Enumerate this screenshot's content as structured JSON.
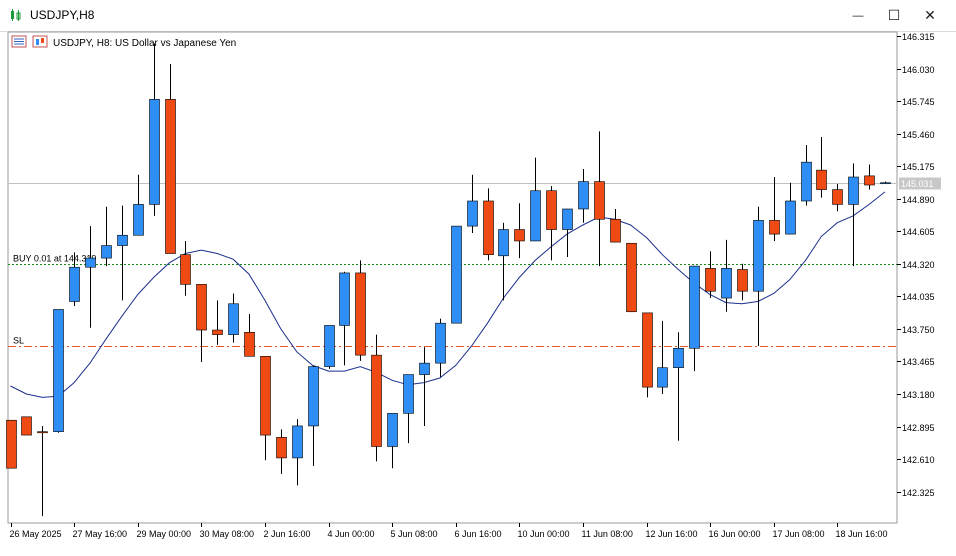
{
  "window": {
    "title": "USDJPY,H8",
    "minimize_glyph": "—",
    "maximize_glyph": "☐",
    "close_glyph": "✕"
  },
  "chart_header": {
    "text": "USDJPY, H8:  US Dollar vs Japanese Yen"
  },
  "lines": {
    "buy_label": "BUY 0.01 at 144.319",
    "buy_price": 144.319,
    "sl_label": "SL",
    "sl_price": 143.6,
    "current_price": 145.031,
    "current_price_label": "145.031"
  },
  "colors": {
    "bull": "#2f8ef5",
    "bear": "#f04a14",
    "wick": "#000000",
    "ma": "#1c2f8c",
    "buy_line": "#1a8a1a",
    "sl_line": "#e8532a",
    "price_line": "#c0c0c0"
  },
  "chart_data": {
    "type": "candlestick",
    "symbol": "USDJPY",
    "timeframe": "H8",
    "ylim": [
      142.05,
      146.35
    ],
    "y_ticks": [
      "146.315",
      "146.030",
      "145.745",
      "145.460",
      "145.175",
      "144.890",
      "144.605",
      "144.320",
      "144.035",
      "143.750",
      "143.465",
      "143.180",
      "142.895",
      "142.610",
      "142.325"
    ],
    "x_labels": [
      "26 May 2025",
      "27 May 16:00",
      "29 May 00:00",
      "30 May 08:00",
      "2 Jun 16:00",
      "4 Jun 00:00",
      "5 Jun 08:00",
      "6 Jun 16:00",
      "10 Jun 00:00",
      "11 Jun 08:00",
      "12 Jun 16:00",
      "16 Jun 00:00",
      "17 Jun 08:00",
      "18 Jun 16:00"
    ],
    "candles": [
      {
        "o": 142.95,
        "h": 142.95,
        "l": 142.53,
        "c": 142.53
      },
      {
        "o": 142.98,
        "h": 142.98,
        "l": 142.85,
        "c": 142.82
      },
      {
        "o": 142.85,
        "h": 142.9,
        "l": 142.11,
        "c": 142.84
      },
      {
        "o": 142.85,
        "h": 143.92,
        "l": 142.84,
        "c": 143.92
      },
      {
        "o": 143.99,
        "h": 144.42,
        "l": 143.95,
        "c": 144.29
      },
      {
        "o": 144.29,
        "h": 144.65,
        "l": 143.76,
        "c": 144.37
      },
      {
        "o": 144.37,
        "h": 144.82,
        "l": 144.3,
        "c": 144.48
      },
      {
        "o": 144.48,
        "h": 144.83,
        "l": 144.0,
        "c": 144.57
      },
      {
        "o": 144.57,
        "h": 145.1,
        "l": 144.57,
        "c": 144.84
      },
      {
        "o": 144.84,
        "h": 146.25,
        "l": 144.74,
        "c": 145.76
      },
      {
        "o": 145.76,
        "h": 146.07,
        "l": 144.41,
        "c": 144.41
      },
      {
        "o": 144.4,
        "h": 144.52,
        "l": 144.04,
        "c": 144.14
      },
      {
        "o": 144.14,
        "h": 144.14,
        "l": 143.46,
        "c": 143.74
      },
      {
        "o": 143.74,
        "h": 144.0,
        "l": 143.61,
        "c": 143.7
      },
      {
        "o": 143.7,
        "h": 144.06,
        "l": 143.63,
        "c": 143.97
      },
      {
        "o": 143.72,
        "h": 143.88,
        "l": 143.54,
        "c": 143.51
      },
      {
        "o": 143.51,
        "h": 143.51,
        "l": 142.6,
        "c": 142.82
      },
      {
        "o": 142.8,
        "h": 142.87,
        "l": 142.48,
        "c": 142.62
      },
      {
        "o": 142.62,
        "h": 142.96,
        "l": 142.38,
        "c": 142.9
      },
      {
        "o": 142.9,
        "h": 143.43,
        "l": 142.55,
        "c": 143.42
      },
      {
        "o": 143.42,
        "h": 143.78,
        "l": 143.4,
        "c": 143.78
      },
      {
        "o": 143.78,
        "h": 144.25,
        "l": 143.43,
        "c": 144.24
      },
      {
        "o": 144.24,
        "h": 144.35,
        "l": 143.47,
        "c": 143.52
      },
      {
        "o": 143.52,
        "h": 143.7,
        "l": 142.59,
        "c": 142.72
      },
      {
        "o": 142.72,
        "h": 143.01,
        "l": 142.53,
        "c": 143.01
      },
      {
        "o": 143.01,
        "h": 143.35,
        "l": 142.75,
        "c": 143.35
      },
      {
        "o": 143.35,
        "h": 143.59,
        "l": 142.9,
        "c": 143.45
      },
      {
        "o": 143.45,
        "h": 143.84,
        "l": 143.33,
        "c": 143.8
      },
      {
        "o": 143.8,
        "h": 144.65,
        "l": 143.8,
        "c": 144.65
      },
      {
        "o": 144.65,
        "h": 145.1,
        "l": 144.59,
        "c": 144.87
      },
      {
        "o": 144.87,
        "h": 144.98,
        "l": 144.35,
        "c": 144.4
      },
      {
        "o": 144.39,
        "h": 144.68,
        "l": 144.0,
        "c": 144.62
      },
      {
        "o": 144.62,
        "h": 144.85,
        "l": 144.37,
        "c": 144.52
      },
      {
        "o": 144.52,
        "h": 145.25,
        "l": 144.52,
        "c": 144.96
      },
      {
        "o": 144.96,
        "h": 145.0,
        "l": 144.35,
        "c": 144.62
      },
      {
        "o": 144.62,
        "h": 144.8,
        "l": 144.38,
        "c": 144.8
      },
      {
        "o": 144.8,
        "h": 145.15,
        "l": 144.68,
        "c": 145.04
      },
      {
        "o": 145.04,
        "h": 145.48,
        "l": 144.3,
        "c": 144.71
      },
      {
        "o": 144.71,
        "h": 144.8,
        "l": 144.51,
        "c": 144.51
      },
      {
        "o": 144.5,
        "h": 144.5,
        "l": 143.9,
        "c": 143.9
      },
      {
        "o": 143.89,
        "h": 143.89,
        "l": 143.15,
        "c": 143.24
      },
      {
        "o": 143.24,
        "h": 143.82,
        "l": 143.18,
        "c": 143.41
      },
      {
        "o": 143.41,
        "h": 143.72,
        "l": 142.77,
        "c": 143.58
      },
      {
        "o": 143.58,
        "h": 144.3,
        "l": 143.38,
        "c": 144.3
      },
      {
        "o": 144.28,
        "h": 144.43,
        "l": 144.02,
        "c": 144.08
      },
      {
        "o": 144.02,
        "h": 144.53,
        "l": 143.9,
        "c": 144.28
      },
      {
        "o": 144.27,
        "h": 144.32,
        "l": 144.0,
        "c": 144.08
      },
      {
        "o": 144.08,
        "h": 144.82,
        "l": 143.6,
        "c": 144.7
      },
      {
        "o": 144.7,
        "h": 145.08,
        "l": 144.52,
        "c": 144.58
      },
      {
        "o": 144.58,
        "h": 145.03,
        "l": 144.58,
        "c": 144.87
      },
      {
        "o": 144.87,
        "h": 145.36,
        "l": 144.83,
        "c": 145.21
      },
      {
        "o": 145.14,
        "h": 145.43,
        "l": 144.9,
        "c": 144.97
      },
      {
        "o": 144.97,
        "h": 145.02,
        "l": 144.78,
        "c": 144.84
      },
      {
        "o": 144.84,
        "h": 145.2,
        "l": 144.3,
        "c": 145.08
      },
      {
        "o": 145.09,
        "h": 145.19,
        "l": 144.97,
        "c": 145.01
      },
      {
        "o": 145.03,
        "h": 145.04,
        "l": 145.02,
        "c": 145.03
      }
    ],
    "ma": [
      143.25,
      143.18,
      143.15,
      143.16,
      143.28,
      143.45,
      143.66,
      143.86,
      144.05,
      144.2,
      144.33,
      144.41,
      144.44,
      144.41,
      144.36,
      144.23,
      144.0,
      143.75,
      143.55,
      143.43,
      143.38,
      143.38,
      143.42,
      143.37,
      143.3,
      143.26,
      143.28,
      143.32,
      143.43,
      143.6,
      143.8,
      144.02,
      144.2,
      144.35,
      144.47,
      144.58,
      144.66,
      144.73,
      144.71,
      144.66,
      144.55,
      144.4,
      144.27,
      144.15,
      144.05,
      143.98,
      143.97,
      143.99,
      144.06,
      144.18,
      144.35,
      144.56,
      144.68,
      144.74,
      144.84,
      144.95
    ]
  }
}
